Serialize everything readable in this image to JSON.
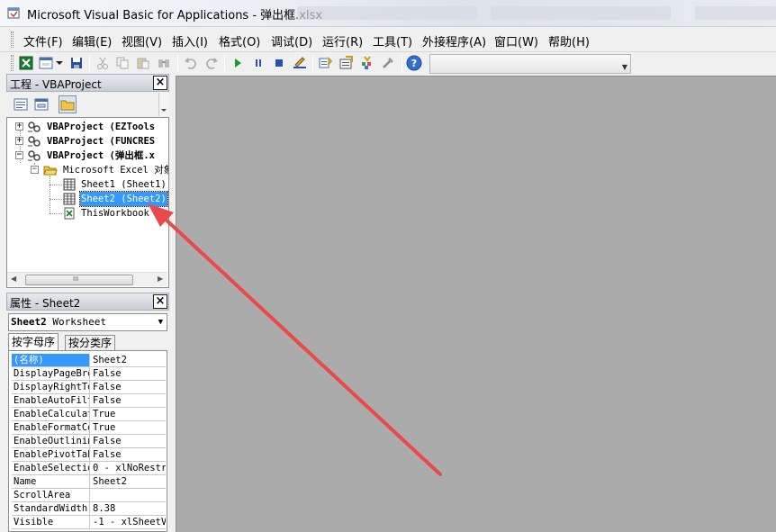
{
  "window": {
    "title": "Microsoft Visual Basic for Applications - 弹出框.xlsx"
  },
  "menu": [
    {
      "id": "file",
      "label": "文件(F)"
    },
    {
      "id": "edit",
      "label": "编辑(E)"
    },
    {
      "id": "view",
      "label": "视图(V)"
    },
    {
      "id": "insert",
      "label": "插入(I)"
    },
    {
      "id": "format",
      "label": "格式(O)"
    },
    {
      "id": "debug",
      "label": "调试(D)"
    },
    {
      "id": "run",
      "label": "运行(R)"
    },
    {
      "id": "tools",
      "label": "工具(T)"
    },
    {
      "id": "addins",
      "label": "外接程序(A)"
    },
    {
      "id": "window",
      "label": "窗口(W)"
    },
    {
      "id": "help",
      "label": "帮助(H)"
    }
  ],
  "toolbar_icons": [
    "excel-icon",
    "insert-userform-icon",
    "dropdown-arrow-icon",
    "save-icon",
    "cut-icon",
    "copy-icon",
    "paste-icon",
    "find-icon",
    "undo-icon",
    "redo-icon",
    "run-icon",
    "break-icon",
    "reset-icon",
    "design-mode-icon",
    "project-explorer-icon",
    "properties-window-icon",
    "object-browser-icon",
    "toolbox-icon",
    "help-icon"
  ],
  "project_panel": {
    "title": "工程 - VBAProject",
    "close": "×",
    "tree": [
      {
        "label": "VBAProject (EZTools",
        "bold": true,
        "expander": "+"
      },
      {
        "label": "VBAProject (FUNCRES",
        "bold": true,
        "expander": "+"
      },
      {
        "label": "VBAProject (弹出框.x",
        "bold": true,
        "expander": "−"
      },
      {
        "label": "Microsoft Excel 对象",
        "bold": false,
        "expander": "−"
      },
      {
        "label": "Sheet1 (Sheet1)",
        "bold": false,
        "expander": ""
      },
      {
        "label": "Sheet2 (Sheet2)",
        "bold": false,
        "expander": "",
        "selected": true
      },
      {
        "label": "ThisWorkbook",
        "bold": false,
        "expander": ""
      }
    ],
    "scroll_grip": "III"
  },
  "properties_panel": {
    "title": "属性 - Sheet2",
    "close": "×",
    "object_name": "Sheet2",
    "object_type": "Worksheet",
    "tabs": [
      "按字母序",
      "按分类序"
    ],
    "rows": [
      {
        "name": "(名称)",
        "value": "Sheet2",
        "selected": true
      },
      {
        "name": "DisplayPageBre",
        "value": "False"
      },
      {
        "name": "DisplayRightTo",
        "value": "False"
      },
      {
        "name": "EnableAutoFilt",
        "value": "False"
      },
      {
        "name": "EnableCalculat",
        "value": "True"
      },
      {
        "name": "EnableFormatCo",
        "value": "True"
      },
      {
        "name": "EnableOutlinin",
        "value": "False"
      },
      {
        "name": "EnablePivotTab",
        "value": "False"
      },
      {
        "name": "EnableSelectio",
        "value": "0 - xlNoRestr"
      },
      {
        "name": "Name",
        "value": "Sheet2"
      },
      {
        "name": "ScrollArea",
        "value": ""
      },
      {
        "name": "StandardWidth",
        "value": "8.38"
      },
      {
        "name": "Visible",
        "value": "-1 - xlSheetV"
      }
    ]
  },
  "colors": {
    "selection": "#3399ff",
    "workspace": "#ababab",
    "annotation_arrow": "#e84a4a"
  }
}
